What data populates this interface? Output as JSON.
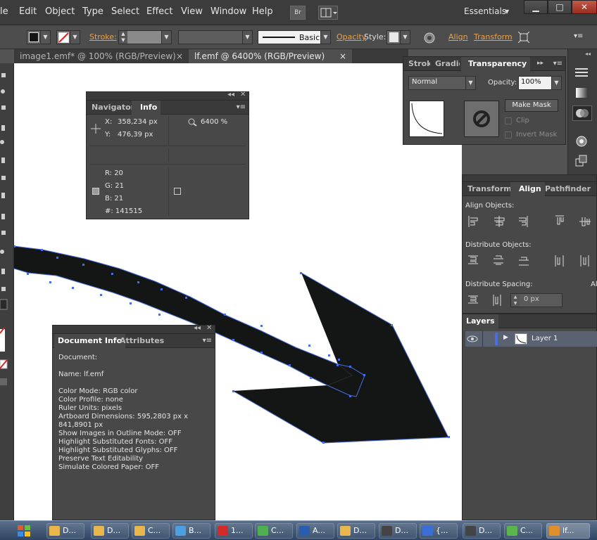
{
  "menubar": {
    "items": [
      "le",
      "Edit",
      "Object",
      "Type",
      "Select",
      "Effect",
      "View",
      "Window",
      "Help"
    ],
    "br_badge": "Br",
    "workspace": "Essentials",
    "window_buttons": [
      "▁",
      "□",
      "✕"
    ]
  },
  "controlbar": {
    "stroke_label": "Stroke:",
    "stroke_style": "Basic",
    "opacity_label": "Opacity",
    "style_label": "Style:",
    "align_label": "Align",
    "transform_label": "Transform"
  },
  "tabs": [
    {
      "label": "image1.emf* @ 100% (RGB/Preview)",
      "close": "×"
    },
    {
      "label": "lf.emf @ 6400% (RGB/Preview)",
      "close": "×"
    }
  ],
  "transparency_panel": {
    "tabs": [
      "Stroke",
      "Gradie",
      "Transparency"
    ],
    "blend_mode": "Normal",
    "opacity_label": "Opacity:",
    "opacity_value": "100%",
    "make_mask": "Make Mask",
    "clip": "Clip",
    "invert_mask": "Invert Mask"
  },
  "info_panel": {
    "tabs": [
      "Navigator",
      "Info"
    ],
    "x_label": "X:",
    "x_value": "358,234 px",
    "y_label": "Y:",
    "y_value": "476,39 px",
    "zoom": "6400 %",
    "r": "R:  20",
    "g": "G:  21",
    "b": "B:  21",
    "hex": "#:  141515"
  },
  "align_panel": {
    "tabs": [
      "Transform",
      "Align",
      "Pathfinder"
    ],
    "align_objects": "Align Objects:",
    "distribute_objects": "Distribute Objects:",
    "distribute_spacing": "Distribute Spacing:",
    "spacing_value": "0 px",
    "align_to_partial": "Al"
  },
  "layers_panel": {
    "title": "Layers",
    "layer_name": "Layer 1"
  },
  "docinfo_panel": {
    "tabs": [
      "Document Info",
      "Attributes"
    ],
    "lines": [
      "Document:",
      "",
      "Name: lf.emf",
      "",
      "Color Mode: RGB color",
      "Color Profile: none",
      "Ruler Units: pixels",
      "Artboard Dimensions: 595,2803 px x",
      "841,8901 px",
      "Show Images in Outline Mode: OFF",
      "Highlight Substituted Fonts: OFF",
      "Highlight Substituted Glyphs: OFF",
      "Preserve Text Editability",
      "Simulate Colored Paper: OFF"
    ]
  },
  "taskbar": {
    "items": [
      "D...",
      "D...",
      "C...",
      "B...",
      "1...",
      "C...",
      "A...",
      "D...",
      "D...",
      "{...",
      "D...",
      "C...",
      "lf..."
    ],
    "colors": [
      "#e8b64a",
      "#e8b64a",
      "#e8b64a",
      "#4aa0e0",
      "#d42a2a",
      "#4fb04f",
      "#2a5db0",
      "#e8b64a",
      "#444444",
      "#3a6fd8",
      "#444444",
      "#5ab54a",
      "#e0902a"
    ]
  },
  "colors": {
    "accent": "#e7a24c",
    "selection": "#4a6ee0",
    "fill": "#141515"
  }
}
